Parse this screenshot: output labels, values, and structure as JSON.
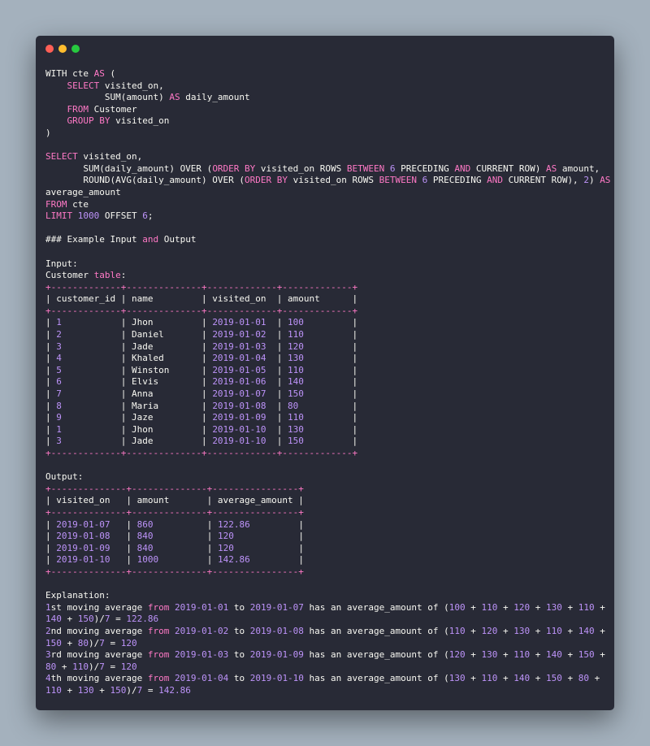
{
  "colors": {
    "plain": "#f8f8f2",
    "keyword": "#ff79c6",
    "number": "#bd93f9",
    "table_border": "#ff79c6"
  },
  "window_controls": [
    {
      "name": "close-window-dot",
      "color": "#ff5f56"
    },
    {
      "name": "minimize-window-dot",
      "color": "#ffbd2e"
    },
    {
      "name": "maximize-window-dot",
      "color": "#27c93f"
    }
  ],
  "code_lines": [
    [
      [
        "WITH cte ",
        "p"
      ],
      [
        "AS",
        "k"
      ],
      [
        " (",
        "p"
      ]
    ],
    [
      [
        "    ",
        "p"
      ],
      [
        "SELECT",
        "k"
      ],
      [
        " visited_on,",
        "p"
      ]
    ],
    [
      [
        "           SUM(amount) ",
        "p"
      ],
      [
        "AS",
        "k"
      ],
      [
        " daily_amount",
        "p"
      ]
    ],
    [
      [
        "    ",
        "p"
      ],
      [
        "FROM",
        "k"
      ],
      [
        " Customer",
        "p"
      ]
    ],
    [
      [
        "    ",
        "p"
      ],
      [
        "GROUP BY",
        "k"
      ],
      [
        " visited_on",
        "p"
      ]
    ],
    [
      [
        ")",
        "p"
      ]
    ],
    [],
    [
      [
        "SELECT",
        "k"
      ],
      [
        " visited_on,",
        "p"
      ]
    ],
    [
      [
        "       SUM(daily_amount) OVER (",
        "p"
      ],
      [
        "ORDER BY",
        "k"
      ],
      [
        " visited_on ROWS ",
        "p"
      ],
      [
        "BETWEEN",
        "k"
      ],
      [
        " ",
        "p"
      ],
      [
        "6",
        "n"
      ],
      [
        " PRECEDING ",
        "p"
      ],
      [
        "AND",
        "k"
      ],
      [
        " CURRENT ROW) ",
        "p"
      ],
      [
        "AS",
        "k"
      ],
      [
        " amount,",
        "p"
      ]
    ],
    [
      [
        "       ROUND(AVG(daily_amount) OVER (",
        "p"
      ],
      [
        "ORDER BY",
        "k"
      ],
      [
        " visited_on ROWS ",
        "p"
      ],
      [
        "BETWEEN",
        "k"
      ],
      [
        " ",
        "p"
      ],
      [
        "6",
        "n"
      ],
      [
        " PRECEDING ",
        "p"
      ],
      [
        "AND",
        "k"
      ],
      [
        " CURRENT ROW), ",
        "p"
      ],
      [
        "2",
        "n"
      ],
      [
        ") ",
        "p"
      ],
      [
        "AS",
        "k"
      ]
    ],
    [
      [
        "average_amount",
        "p"
      ]
    ],
    [
      [
        "FROM",
        "k"
      ],
      [
        " cte",
        "p"
      ]
    ],
    [
      [
        "LIMIT",
        "k"
      ],
      [
        " ",
        "p"
      ],
      [
        "1000",
        "n"
      ],
      [
        " OFFSET ",
        "p"
      ],
      [
        "6",
        "n"
      ],
      [
        ";",
        "p"
      ]
    ],
    [],
    [
      [
        "### Example Input ",
        "p"
      ],
      [
        "and",
        "k"
      ],
      [
        " Output",
        "p"
      ]
    ],
    [],
    [
      [
        "Input:",
        "p"
      ]
    ],
    [
      [
        "Customer ",
        "p"
      ],
      [
        "table",
        "k"
      ],
      [
        ":",
        "p"
      ]
    ],
    [
      [
        "+-------------+--------------+-------------+-------------+",
        "k"
      ]
    ],
    [
      [
        "| customer_id | name         | visited_on  | amount      |",
        "p"
      ]
    ],
    [
      [
        "+-------------+--------------+-------------+-------------+",
        "k"
      ]
    ],
    [
      [
        "| ",
        "p"
      ],
      [
        "1",
        "n"
      ],
      [
        "           | Jhon         | ",
        "p"
      ],
      [
        "2019-01-01",
        "n"
      ],
      [
        "  | ",
        "p"
      ],
      [
        "100",
        "n"
      ],
      [
        "         |",
        "p"
      ]
    ],
    [
      [
        "| ",
        "p"
      ],
      [
        "2",
        "n"
      ],
      [
        "           | Daniel       | ",
        "p"
      ],
      [
        "2019-01-02",
        "n"
      ],
      [
        "  | ",
        "p"
      ],
      [
        "110",
        "n"
      ],
      [
        "         |",
        "p"
      ]
    ],
    [
      [
        "| ",
        "p"
      ],
      [
        "3",
        "n"
      ],
      [
        "           | Jade         | ",
        "p"
      ],
      [
        "2019-01-03",
        "n"
      ],
      [
        "  | ",
        "p"
      ],
      [
        "120",
        "n"
      ],
      [
        "         |",
        "p"
      ]
    ],
    [
      [
        "| ",
        "p"
      ],
      [
        "4",
        "n"
      ],
      [
        "           | Khaled       | ",
        "p"
      ],
      [
        "2019-01-04",
        "n"
      ],
      [
        "  | ",
        "p"
      ],
      [
        "130",
        "n"
      ],
      [
        "         |",
        "p"
      ]
    ],
    [
      [
        "| ",
        "p"
      ],
      [
        "5",
        "n"
      ],
      [
        "           | Winston      | ",
        "p"
      ],
      [
        "2019-01-05",
        "n"
      ],
      [
        "  | ",
        "p"
      ],
      [
        "110",
        "n"
      ],
      [
        "         |",
        "p"
      ]
    ],
    [
      [
        "| ",
        "p"
      ],
      [
        "6",
        "n"
      ],
      [
        "           | Elvis        | ",
        "p"
      ],
      [
        "2019-01-06",
        "n"
      ],
      [
        "  | ",
        "p"
      ],
      [
        "140",
        "n"
      ],
      [
        "         |",
        "p"
      ]
    ],
    [
      [
        "| ",
        "p"
      ],
      [
        "7",
        "n"
      ],
      [
        "           | Anna         | ",
        "p"
      ],
      [
        "2019-01-07",
        "n"
      ],
      [
        "  | ",
        "p"
      ],
      [
        "150",
        "n"
      ],
      [
        "         |",
        "p"
      ]
    ],
    [
      [
        "| ",
        "p"
      ],
      [
        "8",
        "n"
      ],
      [
        "           | Maria        | ",
        "p"
      ],
      [
        "2019-01-08",
        "n"
      ],
      [
        "  | ",
        "p"
      ],
      [
        "80",
        "n"
      ],
      [
        "          |",
        "p"
      ]
    ],
    [
      [
        "| ",
        "p"
      ],
      [
        "9",
        "n"
      ],
      [
        "           | Jaze         | ",
        "p"
      ],
      [
        "2019-01-09",
        "n"
      ],
      [
        "  | ",
        "p"
      ],
      [
        "110",
        "n"
      ],
      [
        "         |",
        "p"
      ]
    ],
    [
      [
        "| ",
        "p"
      ],
      [
        "1",
        "n"
      ],
      [
        "           | Jhon         | ",
        "p"
      ],
      [
        "2019-01-10",
        "n"
      ],
      [
        "  | ",
        "p"
      ],
      [
        "130",
        "n"
      ],
      [
        "         |",
        "p"
      ]
    ],
    [
      [
        "| ",
        "p"
      ],
      [
        "3",
        "n"
      ],
      [
        "           | Jade         | ",
        "p"
      ],
      [
        "2019-01-10",
        "n"
      ],
      [
        "  | ",
        "p"
      ],
      [
        "150",
        "n"
      ],
      [
        "         |",
        "p"
      ]
    ],
    [
      [
        "+-------------+--------------+-------------+-------------+",
        "k"
      ]
    ],
    [],
    [
      [
        "Output:",
        "p"
      ]
    ],
    [
      [
        "+--------------+--------------+----------------+",
        "k"
      ]
    ],
    [
      [
        "| visited_on   | amount       | average_amount |",
        "p"
      ]
    ],
    [
      [
        "+--------------+--------------+----------------+",
        "k"
      ]
    ],
    [
      [
        "| ",
        "p"
      ],
      [
        "2019-01-07",
        "n"
      ],
      [
        "   | ",
        "p"
      ],
      [
        "860",
        "n"
      ],
      [
        "          | ",
        "p"
      ],
      [
        "122.86",
        "n"
      ],
      [
        "         |",
        "p"
      ]
    ],
    [
      [
        "| ",
        "p"
      ],
      [
        "2019-01-08",
        "n"
      ],
      [
        "   | ",
        "p"
      ],
      [
        "840",
        "n"
      ],
      [
        "          | ",
        "p"
      ],
      [
        "120",
        "n"
      ],
      [
        "            |",
        "p"
      ]
    ],
    [
      [
        "| ",
        "p"
      ],
      [
        "2019-01-09",
        "n"
      ],
      [
        "   | ",
        "p"
      ],
      [
        "840",
        "n"
      ],
      [
        "          | ",
        "p"
      ],
      [
        "120",
        "n"
      ],
      [
        "            |",
        "p"
      ]
    ],
    [
      [
        "| ",
        "p"
      ],
      [
        "2019-01-10",
        "n"
      ],
      [
        "   | ",
        "p"
      ],
      [
        "1000",
        "n"
      ],
      [
        "         | ",
        "p"
      ],
      [
        "142.86",
        "n"
      ],
      [
        "         |",
        "p"
      ]
    ],
    [
      [
        "+--------------+--------------+----------------+",
        "k"
      ]
    ],
    [],
    [
      [
        "Explanation:",
        "p"
      ]
    ],
    [
      [
        "1",
        "n"
      ],
      [
        "st moving average ",
        "p"
      ],
      [
        "from",
        "k"
      ],
      [
        " ",
        "p"
      ],
      [
        "2019-01-01",
        "n"
      ],
      [
        " to ",
        "p"
      ],
      [
        "2019-01-07",
        "n"
      ],
      [
        " has an average_amount of (",
        "p"
      ],
      [
        "100",
        "n"
      ],
      [
        " + ",
        "p"
      ],
      [
        "110",
        "n"
      ],
      [
        " + ",
        "p"
      ],
      [
        "120",
        "n"
      ],
      [
        " + ",
        "p"
      ],
      [
        "130",
        "n"
      ],
      [
        " + ",
        "p"
      ],
      [
        "110",
        "n"
      ],
      [
        " +",
        "p"
      ]
    ],
    [
      [
        "140",
        "n"
      ],
      [
        " + ",
        "p"
      ],
      [
        "150",
        "n"
      ],
      [
        ")/",
        "p"
      ],
      [
        "7",
        "n"
      ],
      [
        " = ",
        "p"
      ],
      [
        "122.86",
        "n"
      ]
    ],
    [
      [
        "2",
        "n"
      ],
      [
        "nd moving average ",
        "p"
      ],
      [
        "from",
        "k"
      ],
      [
        " ",
        "p"
      ],
      [
        "2019-01-02",
        "n"
      ],
      [
        " to ",
        "p"
      ],
      [
        "2019-01-08",
        "n"
      ],
      [
        " has an average_amount of (",
        "p"
      ],
      [
        "110",
        "n"
      ],
      [
        " + ",
        "p"
      ],
      [
        "120",
        "n"
      ],
      [
        " + ",
        "p"
      ],
      [
        "130",
        "n"
      ],
      [
        " + ",
        "p"
      ],
      [
        "110",
        "n"
      ],
      [
        " + ",
        "p"
      ],
      [
        "140",
        "n"
      ],
      [
        " +",
        "p"
      ]
    ],
    [
      [
        "150",
        "n"
      ],
      [
        " + ",
        "p"
      ],
      [
        "80",
        "n"
      ],
      [
        ")/",
        "p"
      ],
      [
        "7",
        "n"
      ],
      [
        " = ",
        "p"
      ],
      [
        "120",
        "n"
      ]
    ],
    [
      [
        "3",
        "n"
      ],
      [
        "rd moving average ",
        "p"
      ],
      [
        "from",
        "k"
      ],
      [
        " ",
        "p"
      ],
      [
        "2019-01-03",
        "n"
      ],
      [
        " to ",
        "p"
      ],
      [
        "2019-01-09",
        "n"
      ],
      [
        " has an average_amount of (",
        "p"
      ],
      [
        "120",
        "n"
      ],
      [
        " + ",
        "p"
      ],
      [
        "130",
        "n"
      ],
      [
        " + ",
        "p"
      ],
      [
        "110",
        "n"
      ],
      [
        " + ",
        "p"
      ],
      [
        "140",
        "n"
      ],
      [
        " + ",
        "p"
      ],
      [
        "150",
        "n"
      ],
      [
        " +",
        "p"
      ]
    ],
    [
      [
        "80",
        "n"
      ],
      [
        " + ",
        "p"
      ],
      [
        "110",
        "n"
      ],
      [
        ")/",
        "p"
      ],
      [
        "7",
        "n"
      ],
      [
        " = ",
        "p"
      ],
      [
        "120",
        "n"
      ]
    ],
    [
      [
        "4",
        "n"
      ],
      [
        "th moving average ",
        "p"
      ],
      [
        "from",
        "k"
      ],
      [
        " ",
        "p"
      ],
      [
        "2019-01-04",
        "n"
      ],
      [
        " to ",
        "p"
      ],
      [
        "2019-01-10",
        "n"
      ],
      [
        " has an average_amount of (",
        "p"
      ],
      [
        "130",
        "n"
      ],
      [
        " + ",
        "p"
      ],
      [
        "110",
        "n"
      ],
      [
        " + ",
        "p"
      ],
      [
        "140",
        "n"
      ],
      [
        " + ",
        "p"
      ],
      [
        "150",
        "n"
      ],
      [
        " + ",
        "p"
      ],
      [
        "80",
        "n"
      ],
      [
        " +",
        "p"
      ]
    ],
    [
      [
        "110",
        "n"
      ],
      [
        " + ",
        "p"
      ],
      [
        "130",
        "n"
      ],
      [
        " + ",
        "p"
      ],
      [
        "150",
        "n"
      ],
      [
        ")/",
        "p"
      ],
      [
        "7",
        "n"
      ],
      [
        " = ",
        "p"
      ],
      [
        "142.86",
        "n"
      ]
    ]
  ]
}
